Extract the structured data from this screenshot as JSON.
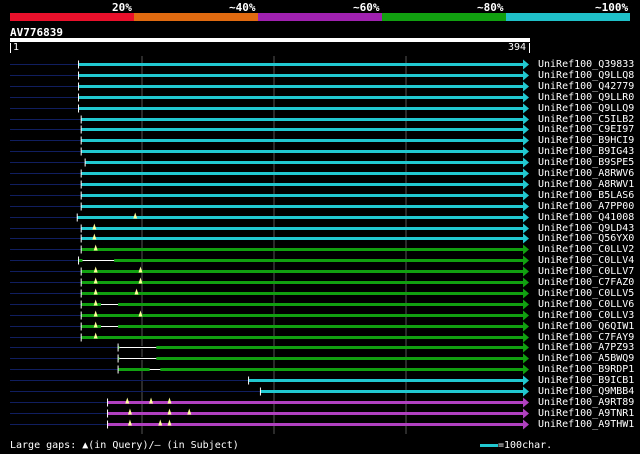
{
  "legend": {
    "segments": [
      {
        "color": "#e8102a"
      },
      {
        "color": "#e06a10"
      },
      {
        "color": "#a020b0"
      },
      {
        "color": "#10a010"
      },
      {
        "color": "#20c0c8"
      }
    ],
    "labels": [
      "20%",
      "~40%",
      "~60%",
      "~80%",
      "~100%"
    ]
  },
  "query": {
    "id": "AV776839",
    "start": "1",
    "end": "394",
    "length": 394
  },
  "colors": {
    "cyan": "#22c8d0",
    "green": "#10a010",
    "purple": "#b040c0",
    "navy": "#101e60",
    "gap_marker": "#ffff99",
    "grid": "#555555"
  },
  "hits": [
    {
      "label": "UniRef100_Q39833",
      "color": "cyan",
      "start": 53,
      "end": 394,
      "q_gaps": [],
      "s_gaps": []
    },
    {
      "label": "UniRef100_Q9LLQ8",
      "color": "cyan",
      "start": 53,
      "end": 394,
      "q_gaps": [],
      "s_gaps": []
    },
    {
      "label": "UniRef100_Q42779",
      "color": "cyan",
      "start": 53,
      "end": 394,
      "q_gaps": [],
      "s_gaps": []
    },
    {
      "label": "UniRef100_Q9LLR0",
      "color": "cyan",
      "start": 53,
      "end": 394,
      "q_gaps": [],
      "s_gaps": []
    },
    {
      "label": "UniRef100_Q9LLQ9",
      "color": "cyan",
      "start": 53,
      "end": 394,
      "q_gaps": [],
      "s_gaps": []
    },
    {
      "label": "UniRef100_C5ILB2",
      "color": "cyan",
      "start": 55,
      "end": 394,
      "q_gaps": [],
      "s_gaps": []
    },
    {
      "label": "UniRef100_C9EI97",
      "color": "cyan",
      "start": 55,
      "end": 394,
      "q_gaps": [],
      "s_gaps": []
    },
    {
      "label": "UniRef100_B9HCI9",
      "color": "cyan",
      "start": 55,
      "end": 394,
      "q_gaps": [],
      "s_gaps": []
    },
    {
      "label": "UniRef100_B9IG43",
      "color": "cyan",
      "start": 55,
      "end": 394,
      "q_gaps": [],
      "s_gaps": []
    },
    {
      "label": "UniRef100_B9SPE5",
      "color": "cyan",
      "start": 58,
      "end": 394,
      "q_gaps": [],
      "s_gaps": []
    },
    {
      "label": "UniRef100_A8RWV6",
      "color": "cyan",
      "start": 55,
      "end": 394,
      "q_gaps": [],
      "s_gaps": []
    },
    {
      "label": "UniRef100_A8RWV1",
      "color": "cyan",
      "start": 55,
      "end": 394,
      "q_gaps": [],
      "s_gaps": []
    },
    {
      "label": "UniRef100_B5LAS6",
      "color": "cyan",
      "start": 55,
      "end": 394,
      "q_gaps": [],
      "s_gaps": []
    },
    {
      "label": "UniRef100_A7PP00",
      "color": "cyan",
      "start": 55,
      "end": 394,
      "q_gaps": [],
      "s_gaps": []
    },
    {
      "label": "UniRef100_Q41008",
      "color": "cyan",
      "start": 52,
      "end": 394,
      "q_gaps": [
        96
      ],
      "s_gaps": []
    },
    {
      "label": "UniRef100_Q9LD43",
      "color": "cyan",
      "start": 55,
      "end": 394,
      "q_gaps": [
        65
      ],
      "s_gaps": []
    },
    {
      "label": "UniRef100_Q56YX0",
      "color": "cyan",
      "start": 55,
      "end": 394,
      "q_gaps": [
        65
      ],
      "s_gaps": []
    },
    {
      "label": "UniRef100_C0LLV2",
      "color": "green",
      "start": 55,
      "end": 394,
      "q_gaps": [
        66
      ],
      "s_gaps": []
    },
    {
      "label": "UniRef100_C0LLV4",
      "color": "green",
      "start": 53,
      "end": 394,
      "q_gaps": [],
      "s_gaps": [
        [
          56,
          80
        ]
      ]
    },
    {
      "label": "UniRef100_C0LLV7",
      "color": "green",
      "start": 55,
      "end": 394,
      "q_gaps": [
        66,
        100
      ],
      "s_gaps": []
    },
    {
      "label": "UniRef100_C7FAZ0",
      "color": "green",
      "start": 55,
      "end": 394,
      "q_gaps": [
        66,
        100
      ],
      "s_gaps": []
    },
    {
      "label": "UniRef100_C0LLV5",
      "color": "green",
      "start": 55,
      "end": 394,
      "q_gaps": [
        66,
        97
      ],
      "s_gaps": []
    },
    {
      "label": "UniRef100_C0LLV6",
      "color": "green",
      "start": 55,
      "end": 394,
      "q_gaps": [
        66
      ],
      "s_gaps": [
        [
          70,
          83
        ]
      ]
    },
    {
      "label": "UniRef100_C0LLV3",
      "color": "green",
      "start": 55,
      "end": 394,
      "q_gaps": [
        66,
        100
      ],
      "s_gaps": []
    },
    {
      "label": "UniRef100_Q6QIW1",
      "color": "green",
      "start": 55,
      "end": 394,
      "q_gaps": [
        66
      ],
      "s_gaps": [
        [
          70,
          83
        ]
      ]
    },
    {
      "label": "UniRef100_C7FAY9",
      "color": "green",
      "start": 55,
      "end": 394,
      "q_gaps": [
        66
      ],
      "s_gaps": []
    },
    {
      "label": "UniRef100_A7PZ93",
      "color": "green",
      "start": 83,
      "end": 394,
      "q_gaps": [],
      "s_gaps": [
        [
          84,
          112
        ]
      ]
    },
    {
      "label": "UniRef100_A5BWQ9",
      "color": "green",
      "start": 83,
      "end": 394,
      "q_gaps": [],
      "s_gaps": [
        [
          84,
          112
        ]
      ]
    },
    {
      "label": "UniRef100_B9RDP1",
      "color": "green",
      "start": 83,
      "end": 394,
      "q_gaps": [],
      "s_gaps": [
        [
          107,
          115
        ]
      ]
    },
    {
      "label": "UniRef100_B9ICB1",
      "color": "cyan",
      "start": 182,
      "end": 394,
      "q_gaps": [],
      "s_gaps": []
    },
    {
      "label": "UniRef100_Q9MBB4",
      "color": "cyan",
      "start": 191,
      "end": 394,
      "q_gaps": [],
      "s_gaps": []
    },
    {
      "label": "UniRef100_A9RT89",
      "color": "purple",
      "start": 75,
      "end": 394,
      "q_gaps": [
        90,
        108,
        122
      ],
      "s_gaps": []
    },
    {
      "label": "UniRef100_A9TNR1",
      "color": "purple",
      "start": 75,
      "end": 394,
      "q_gaps": [
        92,
        122,
        137
      ],
      "s_gaps": []
    },
    {
      "label": "UniRef100_A9THW1",
      "color": "purple",
      "start": 75,
      "end": 394,
      "q_gaps": [
        92,
        115,
        122
      ],
      "s_gaps": []
    }
  ],
  "footer": {
    "gaps_text": "Large gaps: ▲(in Query)/— (in Subject)",
    "scale_text": "=100char."
  }
}
